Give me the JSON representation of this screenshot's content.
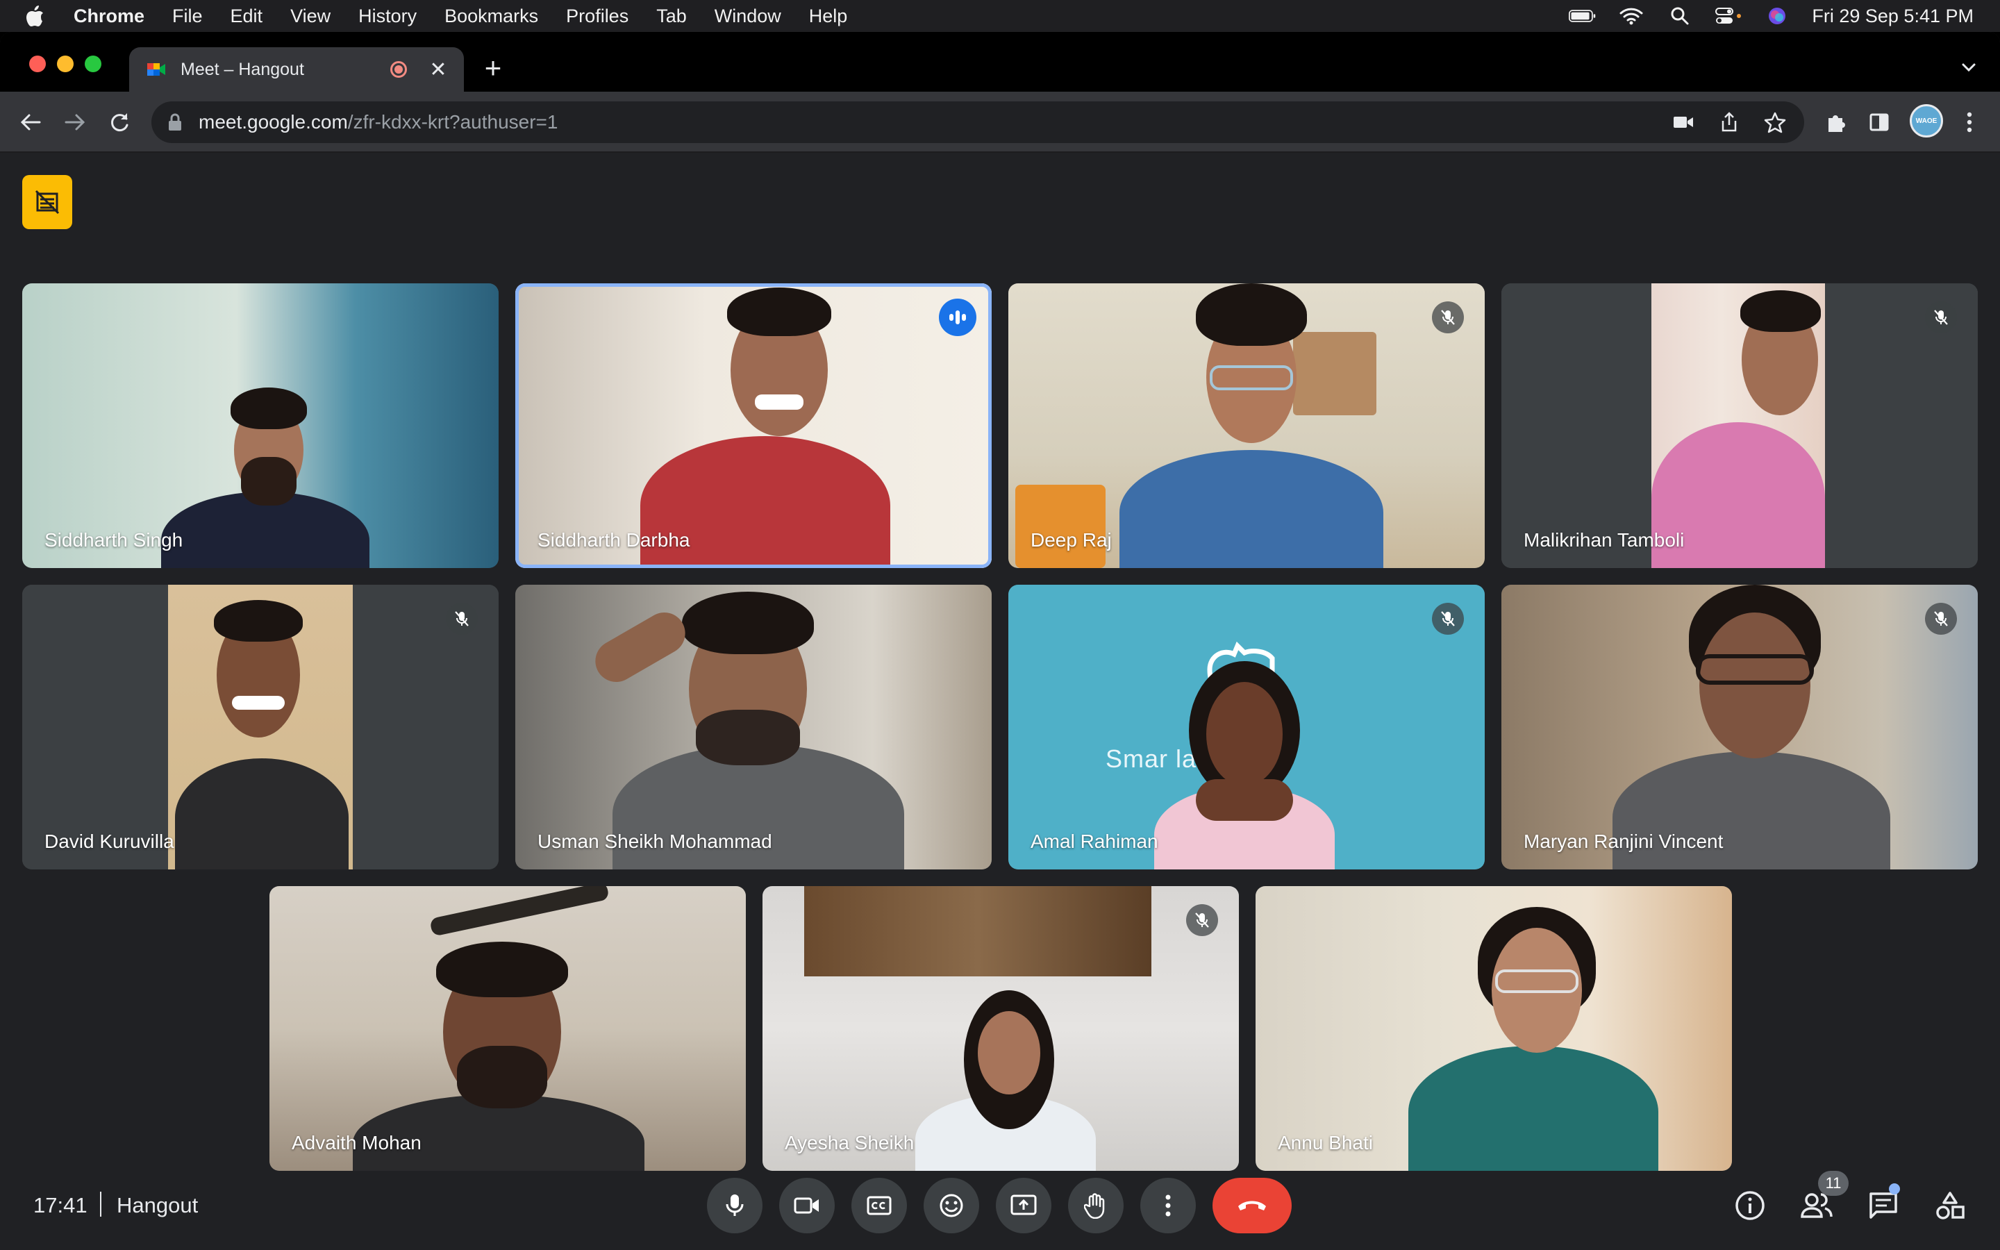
{
  "menubar": {
    "app_name": "Chrome",
    "items": [
      "File",
      "Edit",
      "View",
      "History",
      "Bookmarks",
      "Profiles",
      "Tab",
      "Window",
      "Help"
    ],
    "date_time": "Fri 29 Sep  5:41 PM"
  },
  "browser": {
    "tab_title": "Meet – Hangout",
    "tab_close": "✕",
    "new_tab": "+",
    "url_host": "meet.google.com",
    "url_path": "/zfr-kdxx-krt?authuser=1",
    "profile_initials": "WAOE"
  },
  "participants": [
    {
      "name": "Siddharth Singh",
      "muted": false,
      "speaking": false
    },
    {
      "name": "Siddharth Darbha",
      "muted": false,
      "speaking": true
    },
    {
      "name": "Deep Raj",
      "muted": true,
      "speaking": false
    },
    {
      "name": "Malikrihan Tamboli",
      "muted": true,
      "speaking": false
    },
    {
      "name": "David Kuruvilla",
      "muted": true,
      "speaking": false
    },
    {
      "name": "Usman Sheikh Mohammad",
      "muted": false,
      "speaking": false
    },
    {
      "name": "Amal Rahiman",
      "muted": true,
      "speaking": false
    },
    {
      "name": "Maryan Ranjini Vincent",
      "muted": true,
      "speaking": false
    },
    {
      "name": "Advaith Mohan",
      "muted": false,
      "speaking": false
    },
    {
      "name": "Ayesha Sheikh",
      "muted": true,
      "speaking": false
    },
    {
      "name": "Annu Bhati",
      "muted": false,
      "speaking": false
    }
  ],
  "background_text": "Smar         latform",
  "meeting": {
    "time": "17:41",
    "name": "Hangout",
    "participant_count": "11"
  },
  "colors": {
    "background": "#202124",
    "tile": "#3c4043",
    "accent_blue": "#8ab4f8",
    "end_call": "#ea4335",
    "notice": "#fbbc04"
  }
}
